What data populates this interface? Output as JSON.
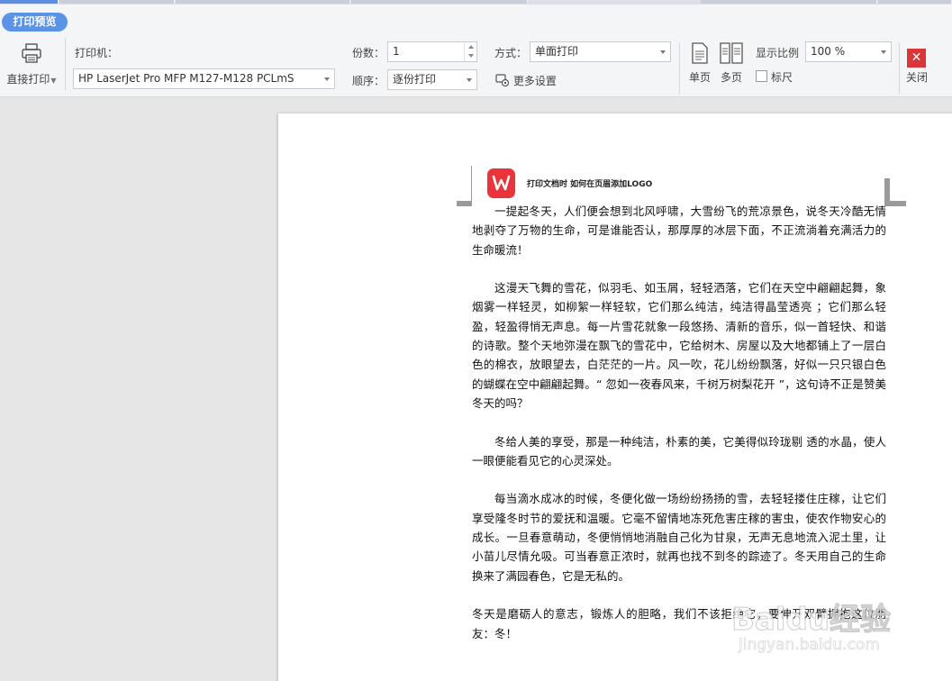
{
  "toolbar": {
    "title": "打印预览",
    "direct_print_label": "直接打印",
    "printer_label": "打印机：",
    "printer_value": "HP LaserJet Pro MFP M127-M128 PCLmS",
    "copies_label": "份数：",
    "copies_value": "1",
    "order_label": "顺序：",
    "order_value": "逐份打印",
    "mode_label": "方式：",
    "mode_value": "单面打印",
    "more_settings_label": "更多设置",
    "single_page_label": "单页",
    "multi_page_label": "多页",
    "zoom_label": "显示比例",
    "zoom_value": "100 %",
    "ruler_label": "标尺",
    "close_label": "关闭"
  },
  "document": {
    "header_text": "打印文档时 如何在页眉添加LOGO",
    "paragraphs": [
      "一提起冬天，人们便会想到北风呼啸，大雪纷飞的荒凉景色，说冬天冷酷无情地剥夺了万物的生命，可是谁能否认，那厚厚的冰层下面，不正流淌着充满活力的生命暖流！",
      "这漫天飞舞的雪花，似羽毛、如玉屑，轻轻洒落，它们在天空中翩翩起舞，象烟雾一样轻灵，如柳絮一样轻软，它们那么纯洁，纯洁得晶莹透亮 ；它们那么轻盈，轻盈得悄无声息。每一片雪花就象一段悠扬、清新的音乐，似一首轻快、和谐的诗歌。整个天地弥漫在飘飞的雪花中，它给树木、房屋以及大地都铺上了一层白色的棉衣，放眼望去，白茫茫的一片。风一吹，花儿纷纷飘落，好似一只只银白色的蝴蝶在空中翩翩起舞。“ 忽如一夜春风来，千树万树梨花开 ”，这句诗不正是赞美冬天的吗？",
      "冬给人美的享受，那是一种纯洁，朴素的美，它美得似玲珑剔 透的水晶，使人一眼便能看见它的心灵深处。",
      "每当滴水成冰的时候，冬便化做一场纷纷扬扬的雪，去轻轻搂住庄稼，让它们享受隆冬时节的爱抚和温暖。它毫不留情地冻死危害庄稼的害虫，使农作物安心的成长。一旦春意萌动，冬便悄悄地消融自己化为甘泉，无声无息地流入泥土里，让小苗儿尽情允吸。可当春意正浓时，就再也找不到冬的踪迹了。冬天用自己的生命换来了满园春色，它是无私的。",
      "冬天是磨砺人的意志，锻炼人的胆略，我们不该拒绝它，要伸开双臂拥抱这位朋友：冬！"
    ]
  },
  "watermark": {
    "brand": "Baidu经验",
    "url": "jingyan.baidu.com"
  },
  "colors": {
    "accent": "#5b93e6",
    "close": "#d9363a",
    "logo": "#e8343a"
  }
}
